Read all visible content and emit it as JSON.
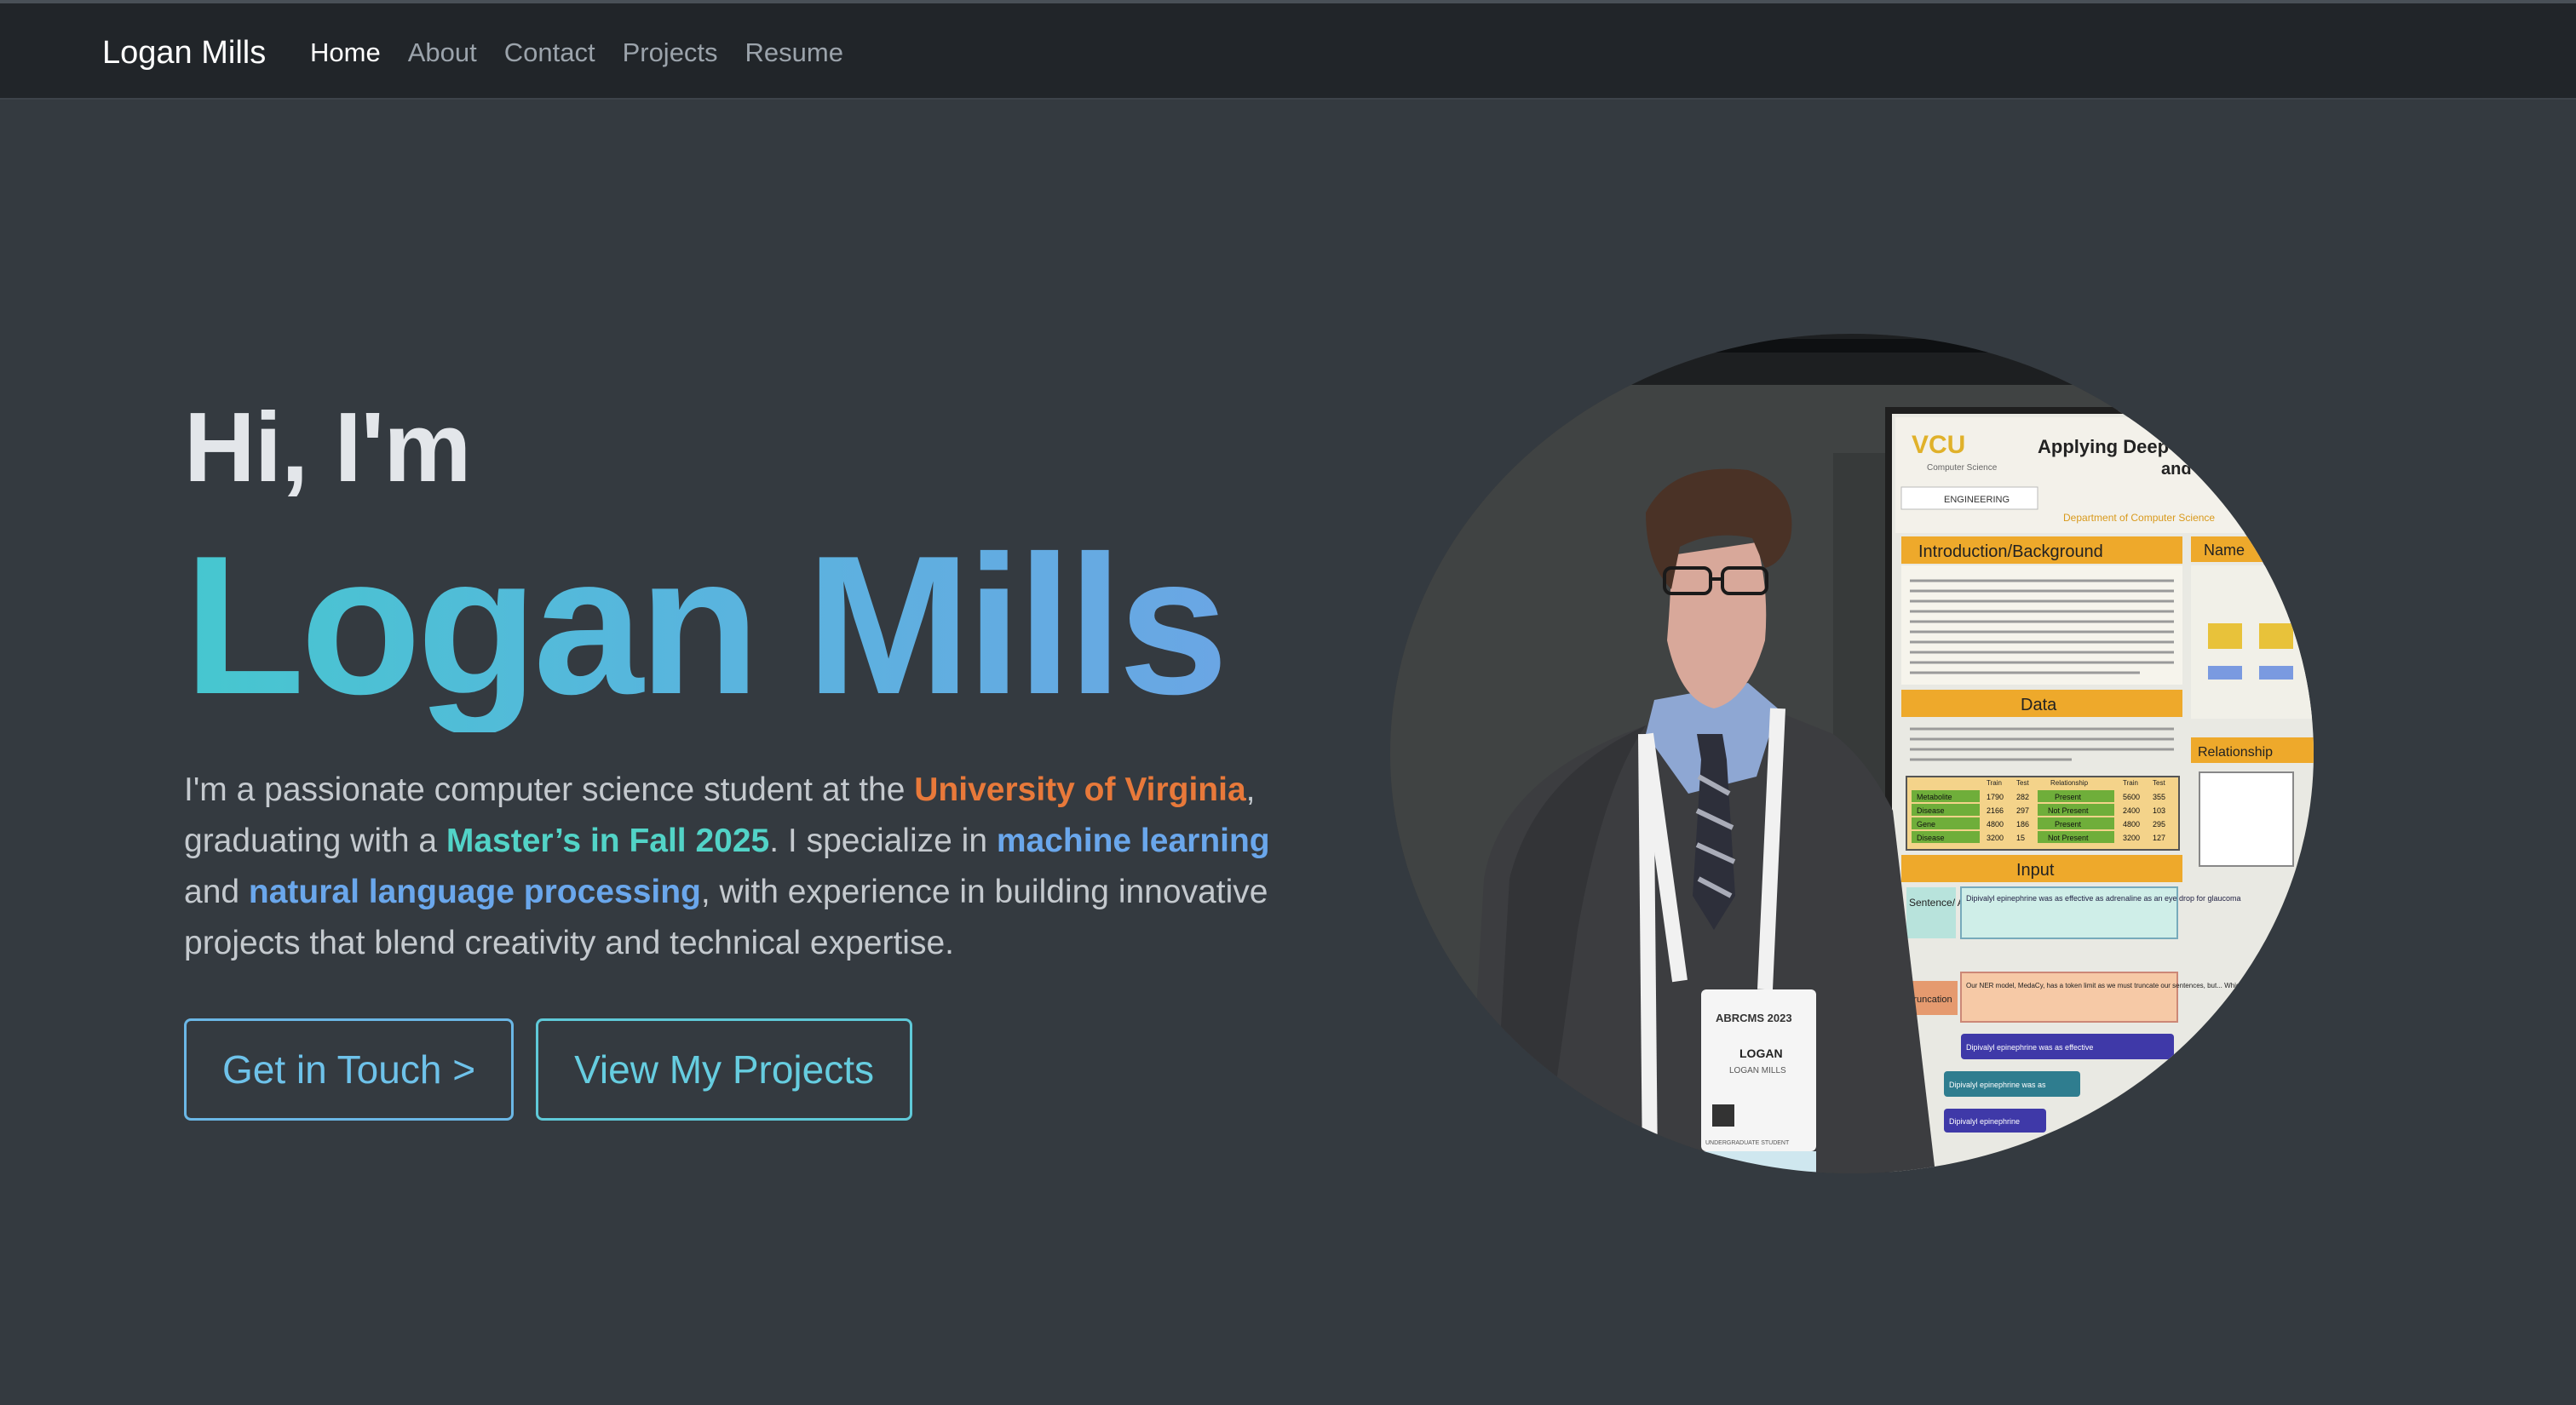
{
  "navbar": {
    "brand": "Logan Mills",
    "links": [
      {
        "label": "Home",
        "active": true
      },
      {
        "label": "About",
        "active": false
      },
      {
        "label": "Contact",
        "active": false
      },
      {
        "label": "Projects",
        "active": false
      },
      {
        "label": "Resume",
        "active": false
      }
    ]
  },
  "hero": {
    "greeting": "Hi, I'm",
    "name": "Logan Mills",
    "bio": {
      "part1": "I'm a passionate computer science student at the ",
      "university": "University of Virginia",
      "part2": ", graduating with a ",
      "degree": "Master’s in Fall 2025",
      "part3": ". I specialize in ",
      "field1": "machine learning",
      "part4": " and ",
      "field2": "natural language processing",
      "part5": ", with experience in building innovative projects that blend creativity and technical expertise."
    },
    "buttons": {
      "contact": "Get in Touch >",
      "projects": "View My Projects"
    }
  },
  "photo": {
    "poster": {
      "logo": "VCU",
      "logo_sub": "Computer Science",
      "title": "Applying Deep",
      "title2": "and",
      "dept": "Department of Computer Science",
      "engineering": "ENGINEERING",
      "section_intro": "Introduction/Background",
      "section_data": "Data",
      "section_input": "Input",
      "section_names": "Name",
      "section_relationship": "Relationship",
      "table_headers": [
        "Train",
        "Test",
        "Relationship",
        "Train",
        "Test"
      ],
      "table_rows": [
        [
          "Metabolite",
          "1790",
          "282",
          "Present",
          "5600",
          "355"
        ],
        [
          "Disease",
          "2166",
          "297",
          "Not Present",
          "2400",
          "103"
        ],
        [
          "Gene",
          "4800",
          "186",
          "Present",
          "4800",
          "295"
        ],
        [
          "Disease",
          "3200",
          "15",
          "Not Present",
          "3200",
          "127"
        ]
      ],
      "sentence_label": "Sentence/ Annotation",
      "sentence_text": "Dipivalyl epinephrine was as effective as adrenaline as an eye drop for glaucoma",
      "truncation_label": "Truncation",
      "truncation_text": "Our NER model, MedaCy, has a token limit as we must truncate our sentences, but... Which truncation method is best?",
      "bar1": "Dipivalyl epinephrine was as effective",
      "bar2": "Dipivalyl epinephrine was as",
      "bar3": "Dipivalyl epinephrine"
    },
    "badge": {
      "event": "ABRCMS 2023",
      "first": "LOGAN",
      "full": "LOGAN MILLS",
      "role": "UNDERGRADUATE STUDENT"
    }
  }
}
